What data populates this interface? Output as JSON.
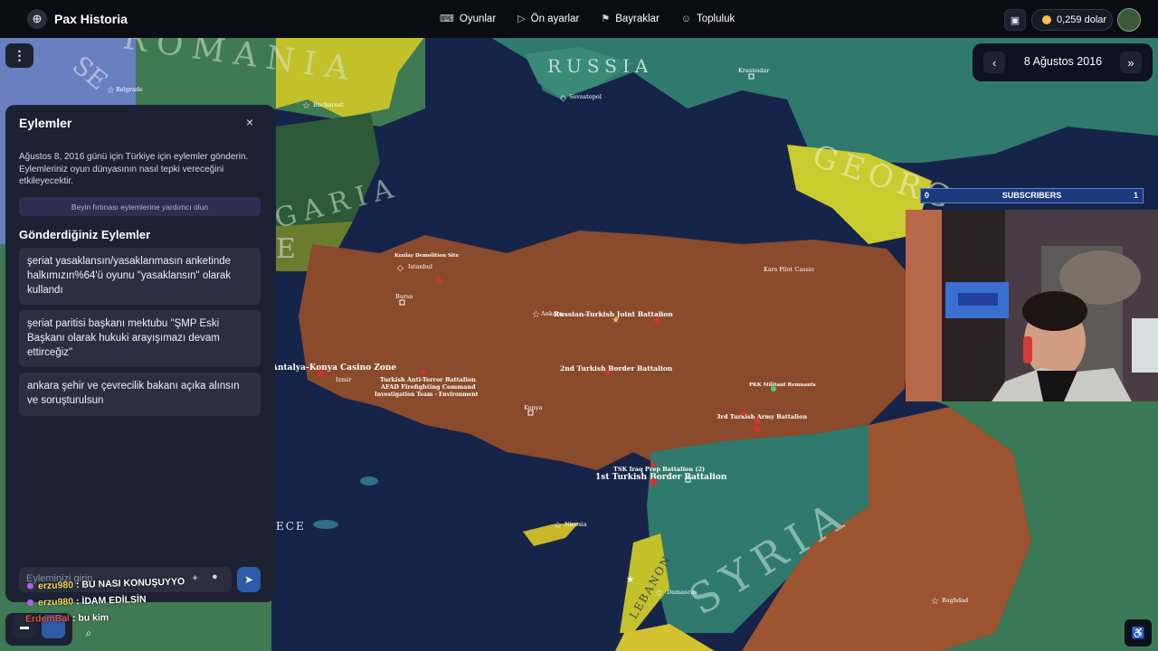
{
  "app": {
    "brand": "Pax Historia"
  },
  "nav": [
    {
      "icon": "⌨",
      "label": "Oyunlar"
    },
    {
      "icon": "▷",
      "label": "Ön ayarlar"
    },
    {
      "icon": "⚑",
      "label": "Bayraklar"
    },
    {
      "icon": "☺",
      "label": "Topluluk"
    }
  ],
  "account": {
    "balance": "0,259 dolar"
  },
  "date_nav": {
    "date": "8 Ağustos 2016",
    "prev_icon": "‹",
    "next_icon": "»"
  },
  "actions_panel": {
    "title": "Eylemler",
    "close_icon": "×",
    "description": "Ağustos 8, 2016 günü için Türkiye için eylemler gönderin. Eylemleriniz oyun dünyasının nasıl tepki vereceğini etkileyecektir.",
    "brainstorm_button": "Beyin fırtınası eylemlerine yardımcı olun",
    "sent_heading": "Gönderdiğiniz Eylemler",
    "sent_actions": [
      "şeriat yasaklansın/yasaklanmasın anketinde halkımızın%64'ü oyunu \"yasaklansın\" olarak kullandı",
      "şeriat paritisi başkanı mektubu \"ŞMP Eski Başkanı olarak hukuki arayışımazı devam ettirceğiz\"",
      "ankara şehir ve çevrecilik bakanı açıka alınsın ve soruşturulsun"
    ],
    "input_placeholder": "Eyleminizi girin"
  },
  "chat_overlay": [
    {
      "user": "erzu980",
      "message": ": BU NASI KONUŞUYYO"
    },
    {
      "user": "erzu980",
      "message": ": İDAM EDİLSİN"
    },
    {
      "user": "ErdemBal",
      "message": ": bu kim"
    }
  ],
  "stream_overlay": {
    "subscribers_label": "SUBSCRIBERS",
    "left_count": "0",
    "right_count": "1"
  },
  "map": {
    "country_labels": [
      "ROMANIA",
      "SE",
      "RUSSIA",
      "GARIA",
      "GEORG",
      "SYRIA",
      "LEBANON",
      "ECE",
      "E"
    ],
    "cities": [
      "Belgrade",
      "Bucharest",
      "Sevastopol",
      "Krasnodar",
      "Istanbul",
      "Bursa",
      "Izmir",
      "Ankara",
      "Konya",
      "Nicosia",
      "Damascus",
      "Baghdad",
      "Kars Pilot Cassio"
    ],
    "units": [
      "Kızılay Demolition Site",
      "Russian-Turkish Joint Battalion",
      "2nd Turkish Border Battalion",
      "Turkish Anti-Terror Battalion",
      "AFAD Firefighting Command",
      "Investigation Team - Environment",
      "Antalya-Konya Casino Zone",
      "PKK Militant Remnants",
      "3rd Turkish Army Battalion",
      "TSK Iraq Prep Battalion (2)",
      "1st Turkish Border Battalion"
    ]
  },
  "colors": {
    "sea": "#17244a",
    "turkey": "#8a4a2c",
    "syria": "#2f7a6c",
    "bulgaria": "#2d5a38",
    "romania": "#3f7a55",
    "yellow_country": "#c2c12a",
    "georgia": "#c9cb2f",
    "panel": "#1d2232",
    "accent": "#2d5ca8"
  }
}
